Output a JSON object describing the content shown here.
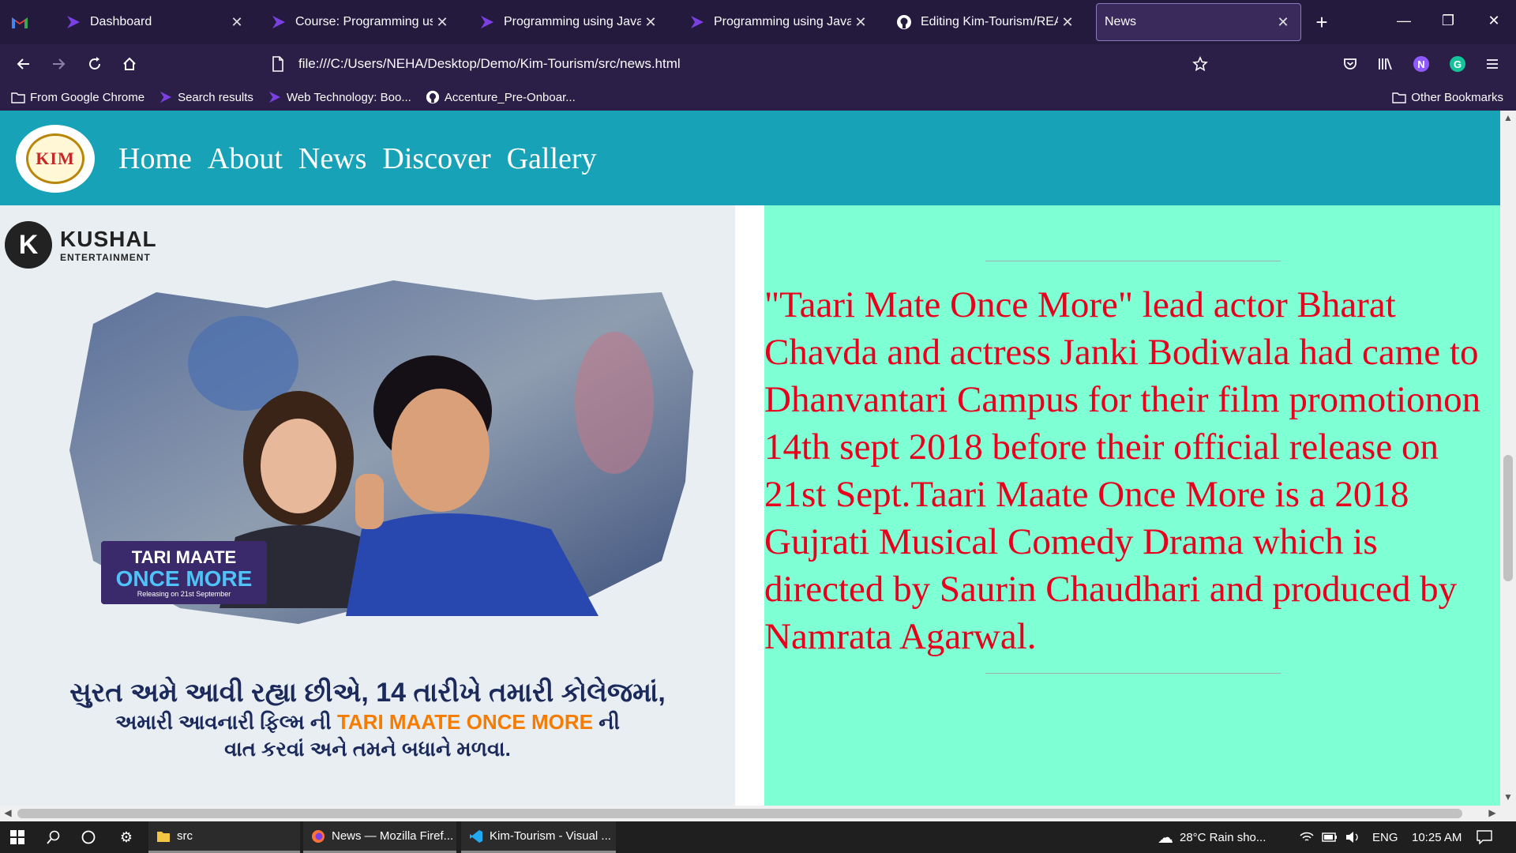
{
  "browser": {
    "tabs": [
      {
        "label": "",
        "favicon": "gmail-icon"
      },
      {
        "label": "Dashboard",
        "favicon": "arrow-icon"
      },
      {
        "label": "Course: Programming using J",
        "favicon": "arrow-icon"
      },
      {
        "label": "Programming using Java Con",
        "favicon": "arrow-icon"
      },
      {
        "label": "Programming using Java Mo",
        "favicon": "arrow-icon"
      },
      {
        "label": "Editing Kim-Tourism/READM",
        "favicon": "github-icon"
      },
      {
        "label": "News",
        "favicon": "",
        "active": true
      }
    ],
    "url": "file:///C:/Users/NEHA/Desktop/Demo/Kim-Tourism/src/news.html",
    "profile_initial": "N",
    "extension_initial": "G",
    "bookmarks": [
      {
        "label": "From Google Chrome",
        "icon": "folder-icon"
      },
      {
        "label": "Search results",
        "icon": "arrow-icon"
      },
      {
        "label": "Web Technology: Boo...",
        "icon": "arrow-icon"
      },
      {
        "label": "Accenture_Pre-Onboar...",
        "icon": "github-icon"
      }
    ],
    "other_bookmarks": "Other Bookmarks"
  },
  "site": {
    "logo_text": "KIM",
    "nav": [
      "Home",
      "About",
      "News",
      "Discover",
      "Gallery"
    ]
  },
  "poster": {
    "brand_name": "KUSHAL",
    "brand_sub": "ENTERTAINMENT",
    "badge_line1": "TARI MAATE",
    "badge_line2": "ONCE MORE",
    "badge_line3": "Releasing on 21st September",
    "tagline_line1": "સુરત અમે આવી રહ્યા છીએ, 14 તારીખે તમારી કોલેજમાં,",
    "tagline_line2a": "અમારી આવનારી ફિલ્મ ની ",
    "tagline_line2b": "TARI MAATE ONCE MORE",
    "tagline_line2c": " ની",
    "tagline_line3": "વાત કરવાં અને તમને બધાને મળવા."
  },
  "article": {
    "text": "\"Taari Mate Once More\" lead actor Bharat Chavda and actress Janki Bodiwala had came to Dhanvantari Campus for their film promotionon 14th sept 2018 before their official release on 21st Sept.Taari Maate Once More is a 2018 Gujrati Musical Comedy Drama which is directed by Saurin Chaudhari and produced by Namrata Agarwal."
  },
  "taskbar": {
    "apps": [
      {
        "label": "src",
        "icon": "folder-icon"
      },
      {
        "label": "News — Mozilla Firef...",
        "icon": "firefox-icon"
      },
      {
        "label": "Kim-Tourism - Visual ...",
        "icon": "vscode-icon"
      }
    ],
    "weather": "28°C  Rain sho...",
    "language": "ENG",
    "time": "10:25 AM"
  },
  "colors": {
    "header": "#17a2b8",
    "article_bg": "#7fffd4",
    "article_text": "#e8001c"
  }
}
